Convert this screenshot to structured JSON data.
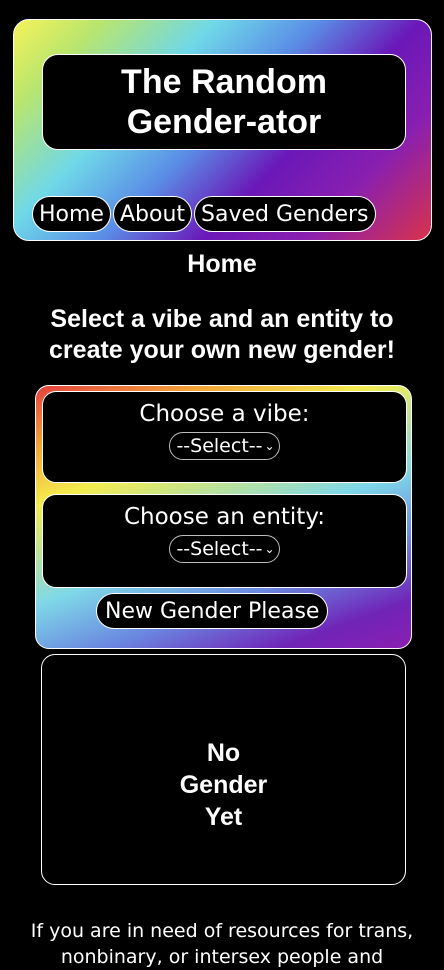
{
  "header": {
    "title": "The Random Gender-ator",
    "nav": {
      "home": "Home",
      "about": "About",
      "saved": "Saved Genders"
    }
  },
  "page": {
    "heading": "Home",
    "intro": "Select a vibe and an entity to create your own new gender!"
  },
  "form": {
    "vibe_label": "Choose a vibe:",
    "vibe_selected": "--Select--",
    "entity_label": "Choose an entity:",
    "entity_selected": "--Select--",
    "generate_button": "New Gender Please"
  },
  "result": {
    "text": "No Gender Yet"
  },
  "footer": {
    "text": "If you are in need of resources for trans, nonbinary, or intersex people and"
  },
  "colors": {
    "background": "#000000",
    "header_gradient": [
      "#f5f25a",
      "#6fd8e8",
      "#6a18b8",
      "#d8334a"
    ],
    "form_gradient": [
      "#e43f3f",
      "#f4ec4f",
      "#7fd8e8",
      "#8a1fb0"
    ]
  }
}
